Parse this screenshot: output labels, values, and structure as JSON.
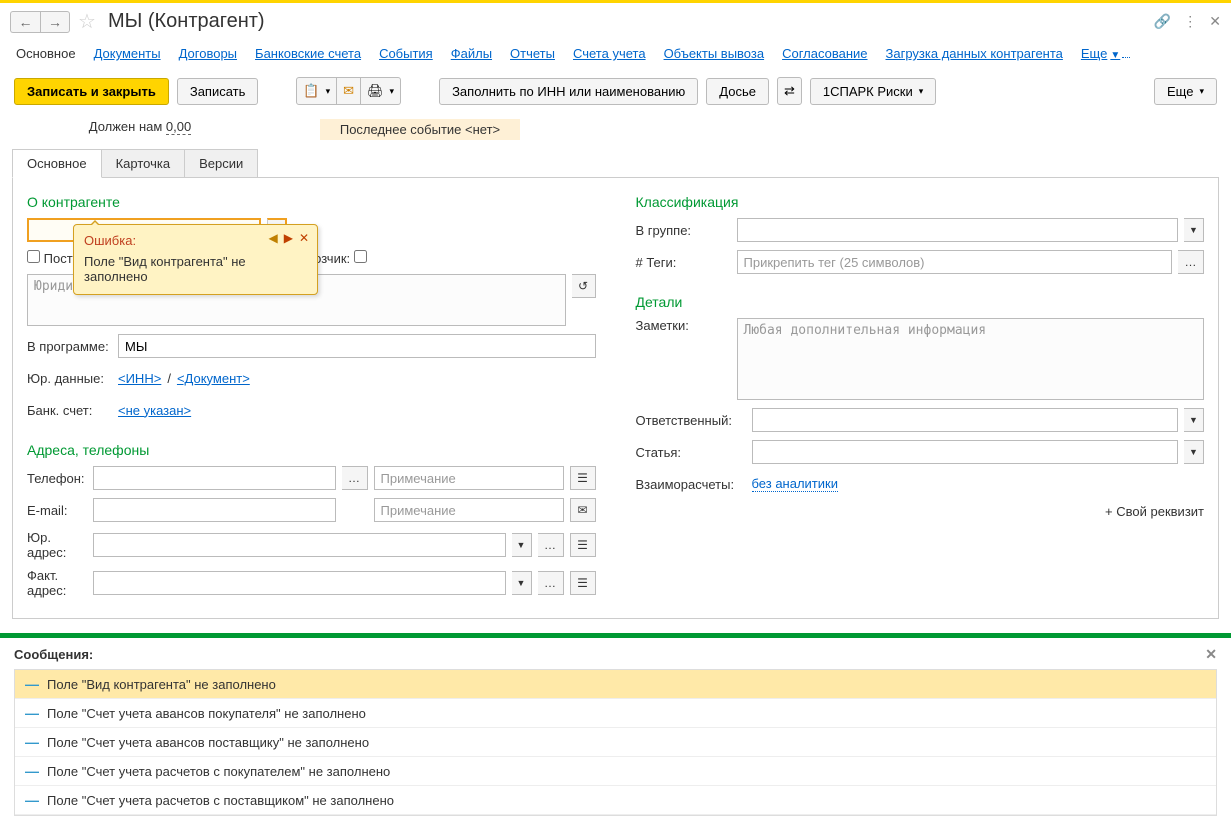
{
  "header": {
    "title": "МЫ (Контрагент)"
  },
  "nav": {
    "main": "Основное",
    "docs": "Документы",
    "contracts": "Договоры",
    "bank": "Банковские счета",
    "events": "События",
    "files": "Файлы",
    "reports": "Отчеты",
    "accounts": "Счета учета",
    "export": "Объекты вывоза",
    "approval": "Согласование",
    "load": "Загрузка данных контрагента",
    "more": "Еще"
  },
  "toolbar": {
    "save_close": "Записать и закрыть",
    "save": "Записать",
    "fill_inn": "Заполнить по ИНН или наименованию",
    "dossier": "Досье",
    "spark": "1СПАРК Риски",
    "more": "Еще"
  },
  "info": {
    "owes_label": "Должен нам",
    "owes_value": "0,00",
    "last_event_label": "Последнее событие",
    "last_event_value": "<нет>"
  },
  "tabs": {
    "main": "Основное",
    "card": "Карточка",
    "versions": "Версии"
  },
  "about": {
    "title": "О контрагенте",
    "supplier": "Поставщик:",
    "carrier": "н перевозчик:",
    "legal_placeholder": "Юридическое...",
    "program_label": "В программе:",
    "program_value": "МЫ",
    "legal_data_label": "Юр. данные:",
    "inn_link": "<ИНН>",
    "doc_link": "<Документ>",
    "bank_label": "Банк. счет:",
    "bank_link": "<не указан>"
  },
  "contacts": {
    "title": "Адреса, телефоны",
    "phone": "Телефон:",
    "email": "E-mail:",
    "note_placeholder": "Примечание",
    "legal_addr": "Юр. адрес:",
    "fact_addr": "Факт. адрес:"
  },
  "class": {
    "title": "Классификация",
    "group": "В группе:",
    "tags": "#  Теги:",
    "tags_placeholder": "Прикрепить тег (25 символов)"
  },
  "details": {
    "title": "Детали",
    "notes": "Заметки:",
    "notes_placeholder": "Любая дополнительная информация",
    "responsible": "Ответственный:",
    "article": "Статья:",
    "settlements": "Взаиморасчеты:",
    "settlements_link": "без аналитики",
    "add_own": "+ Свой реквизит"
  },
  "error_popup": {
    "title": "Ошибка:",
    "text": "Поле \"Вид контрагента\" не заполнено"
  },
  "messages": {
    "title": "Сообщения:",
    "items": [
      "Поле \"Вид контрагента\" не заполнено",
      "Поле \"Счет учета авансов покупателя\" не заполнено",
      "Поле \"Счет учета авансов поставщику\" не заполнено",
      "Поле \"Счет учета расчетов с покупателем\" не заполнено",
      "Поле \"Счет учета расчетов с поставщиком\" не заполнено"
    ]
  }
}
